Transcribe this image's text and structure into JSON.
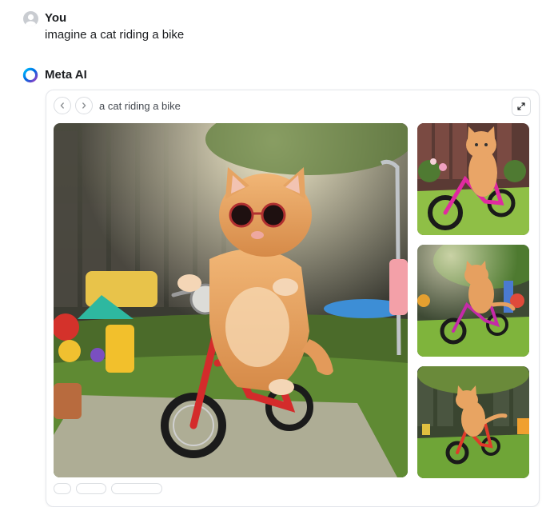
{
  "user_message": {
    "sender": "You",
    "text": "imagine a cat riding a bike"
  },
  "assistant": {
    "name": "Meta AI"
  },
  "image_card": {
    "prompt": "a cat riding a bike",
    "image_count": 4,
    "icons": {
      "prev": "chevron-left-icon",
      "next": "chevron-right-icon",
      "expand": "expand-icon"
    }
  },
  "colors": {
    "text": "#1c1e21",
    "border": "#e4e6eb",
    "meta_gradient": [
      "#0064e0",
      "#a33bc2",
      "#00c2ff"
    ]
  }
}
